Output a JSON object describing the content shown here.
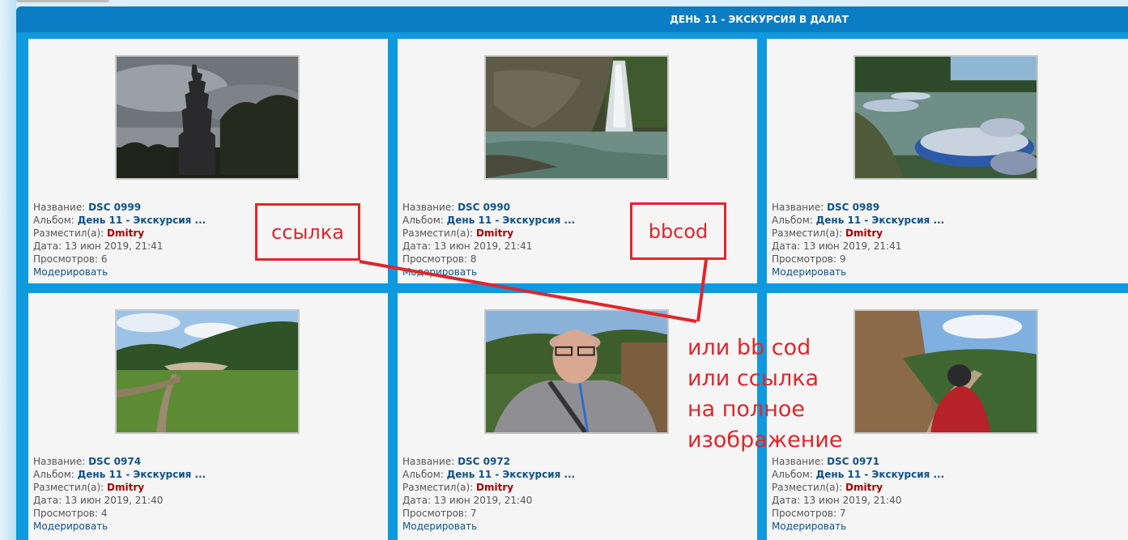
{
  "album": {
    "title": "ДЕНЬ 11 - ЭКСКУРСИЯ В ДАЛАТ"
  },
  "labels": {
    "name": "Название: ",
    "album": "Альбом: ",
    "poster": "Разместил(а): ",
    "date": "Дата: ",
    "views": "Просмотров: ",
    "moderate": "Модерировать"
  },
  "photos": [
    {
      "name": "DSC 0999",
      "album": "День 11 - Экскурсия ...",
      "poster": "Dmitry",
      "date": "13 июн 2019, 21:41",
      "views": "6",
      "image": "pagoda"
    },
    {
      "name": "DSC 0990",
      "album": "День 11 - Экскурсия ...",
      "poster": "Dmitry",
      "date": "13 июн 2019, 21:41",
      "views": "8",
      "image": "waterfall"
    },
    {
      "name": "DSC 0989",
      "album": "День 11 - Экскурсия ...",
      "poster": "Dmitry",
      "date": "13 июн 2019, 21:41",
      "views": "9",
      "image": "boats-lake"
    },
    {
      "name": "DSC 0974",
      "album": "День 11 - Экскурсия ...",
      "poster": "Dmitry",
      "date": "13 июн 2019, 21:40",
      "views": "4",
      "image": "green-field"
    },
    {
      "name": "DSC 0972",
      "album": "День 11 - Экскурсия ...",
      "poster": "Dmitry",
      "date": "13 июн 2019, 21:40",
      "views": "7",
      "image": "selfie"
    },
    {
      "name": "DSC 0971",
      "album": "День 11 - Экскурсия ...",
      "poster": "Dmitry",
      "date": "13 июн 2019, 21:40",
      "views": "7",
      "image": "hiker-path"
    }
  ],
  "annotations": {
    "link_box": "ссылка",
    "bbcode_box": "bbcod",
    "note": "или bb cod\nили ссылка\nна полное\nизображение",
    "color": "#e0262c"
  },
  "colors": {
    "panel": "#0f9ae0",
    "header": "#0b7dc4",
    "cell": "#f5f5f5",
    "link": "#105289",
    "user": "#aa0000"
  }
}
